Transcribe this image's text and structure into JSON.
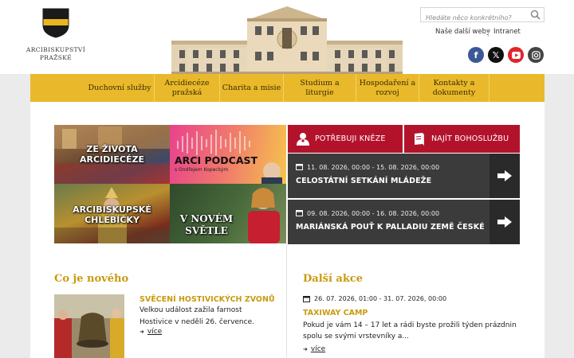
{
  "header": {
    "org_name_line1": "ARCIBISKUPSTVÍ",
    "org_name_line2": "PRAŽSKÉ",
    "search_placeholder": "Hledáte něco konkrétního?",
    "links": [
      "Naše další weby",
      "Intranet"
    ],
    "social": [
      {
        "icon": "facebook-icon",
        "glyph": "f"
      },
      {
        "icon": "x-icon",
        "glyph": "𝕏"
      },
      {
        "icon": "youtube-icon",
        "glyph": "▶"
      },
      {
        "icon": "instagram-icon",
        "glyph": "◎"
      }
    ]
  },
  "nav": {
    "items": [
      {
        "line1": "Duchovní služby",
        "line2": ""
      },
      {
        "line1": "Arcidiecéze",
        "line2": "pražská"
      },
      {
        "line1": "Charita a misie",
        "line2": ""
      },
      {
        "line1": "Studium a",
        "line2": "liturgie"
      },
      {
        "line1": "Hospodaření a",
        "line2": "rozvoj"
      },
      {
        "line1": "Kontakty a",
        "line2": "dokumenty"
      }
    ]
  },
  "tiles": {
    "t1_line1": "ZE ŽIVOTA",
    "t1_line2": "ARCIDIECÉZE",
    "t2_line1": "ARCI PODCAST",
    "t2_line2": "s Ondřejem Kopeckým",
    "t3_line1": "ARCIBISKUPSKÉ",
    "t3_line2": "CHLEBÍČKY",
    "t4_line1": "V NOVÉM",
    "t4_line2": "SVĚTLE"
  },
  "quick_buttons": {
    "priest": "POTŘEBUJI KNĚZE",
    "mass": "NAJÍT BOHOSLUŽBU"
  },
  "featured_events": [
    {
      "date": "11. 08. 2026, 00:00 - 15. 08. 2026, 00:00",
      "name": "CELOSTÁTNÍ SETKÁNÍ MLÁDEŽE"
    },
    {
      "date": "09. 08. 2026, 00:00 - 16. 08. 2026, 00:00",
      "name": "MARIÁNSKÁ POUŤ K PALLADIU ZEMĚ ČESKÉ"
    }
  ],
  "news": {
    "section_title": "Co je nového",
    "title": "SVĚCENÍ HOSTIVICKÝCH ZVONŮ",
    "text": "Velkou událost zažila farnost Hostivice v neděli 26. července.",
    "more": "více"
  },
  "events": {
    "section_title": "Další akce",
    "date": "26. 07. 2026, 01:00 - 31. 07. 2026, 00:00",
    "title": "TAXIWAY CAMP",
    "text": "Pokud je vám 14 – 17 let a rádi byste prožili týden prázdnin spolu se svými vrstevníky a...",
    "more": "více"
  },
  "colors": {
    "gold": "#e9b92b",
    "crimson": "#b3122b",
    "dark": "#3b3b3b",
    "accent_text": "#c99a0f"
  }
}
